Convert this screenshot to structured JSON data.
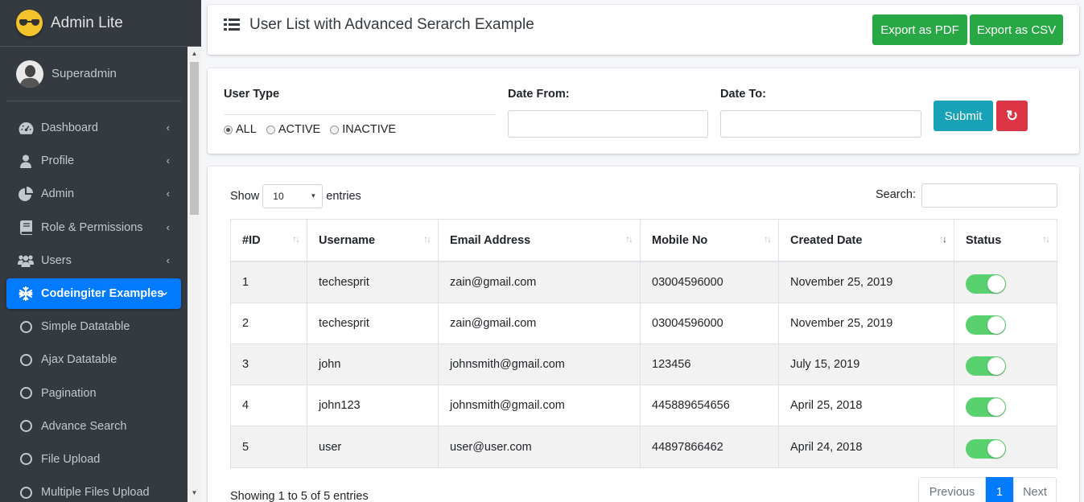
{
  "brand": {
    "name": "Admin Lite"
  },
  "user": {
    "name": "Superadmin"
  },
  "nav": [
    {
      "label": "Dashboard",
      "icon": "dashboard-icon",
      "chevron": "‹"
    },
    {
      "label": "Profile",
      "icon": "user-icon",
      "chevron": "‹"
    },
    {
      "label": "Admin",
      "icon": "pie-chart-icon",
      "chevron": "‹"
    },
    {
      "label": "Role & Permissions",
      "icon": "book-icon",
      "chevron": "‹"
    },
    {
      "label": "Users",
      "icon": "users-icon",
      "chevron": "‹"
    },
    {
      "label": "Codeingiter Examples",
      "icon": "snowflake-icon",
      "chevron": "⌄",
      "active": true
    },
    {
      "label": "Simple Datatable",
      "icon": "circle-icon"
    },
    {
      "label": "Ajax Datatable",
      "icon": "circle-icon"
    },
    {
      "label": "Pagination",
      "icon": "circle-icon"
    },
    {
      "label": "Advance Search",
      "icon": "circle-icon"
    },
    {
      "label": "File Upload",
      "icon": "circle-icon"
    },
    {
      "label": "Multiple Files Upload",
      "icon": "circle-icon"
    }
  ],
  "header": {
    "title": "User List with Advanced Serarch Example",
    "export_pdf": "Export as PDF",
    "export_csv": "Export as CSV"
  },
  "filter": {
    "user_type_label": "User Type",
    "options": [
      "ALL",
      "ACTIVE",
      "INACTIVE"
    ],
    "selected": "ALL",
    "date_from_label": "Date From:",
    "date_to_label": "Date To:",
    "date_from_value": "",
    "date_to_value": "",
    "submit": "Submit",
    "reset_icon": "↻"
  },
  "table": {
    "show_label": "Show",
    "page_size": "10",
    "entries_label": "entries",
    "search_label": "Search:",
    "search_value": "",
    "columns": [
      "#ID",
      "Username",
      "Email Address",
      "Mobile No",
      "Created Date",
      "Status"
    ],
    "sorted_column": "Created Date",
    "rows": [
      {
        "id": "1",
        "username": "techesprit",
        "email": "zain@gmail.com",
        "mobile": "03004596000",
        "created": "November 25, 2019",
        "status": true
      },
      {
        "id": "2",
        "username": "techesprit",
        "email": "zain@gmail.com",
        "mobile": "03004596000",
        "created": "November 25, 2019",
        "status": true
      },
      {
        "id": "3",
        "username": "john",
        "email": "johnsmith@gmail.com",
        "mobile": "123456",
        "created": "July 15, 2019",
        "status": true
      },
      {
        "id": "4",
        "username": "john123",
        "email": "johnsmith@gmail.com",
        "mobile": "445889654656",
        "created": "April 25, 2018",
        "status": true
      },
      {
        "id": "5",
        "username": "user",
        "email": "user@user.com",
        "mobile": "44897866462",
        "created": "April 24, 2018",
        "status": true
      }
    ],
    "info": "Showing 1 to 5 of 5 entries",
    "pagination": {
      "previous": "Previous",
      "current": "1",
      "next": "Next"
    }
  },
  "colors": {
    "sidebar": "#343a40",
    "primary": "#007bff",
    "success": "#28a745",
    "info": "#17a2b8",
    "danger": "#dc3545",
    "toggle_on": "#5ad16f"
  }
}
